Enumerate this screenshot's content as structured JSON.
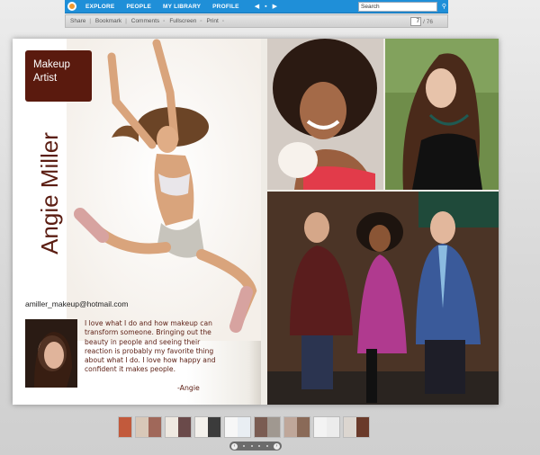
{
  "nav": {
    "items": [
      "EXPLORE",
      "PEOPLE",
      "MY LIBRARY",
      "PROFILE"
    ],
    "search_value": "Search"
  },
  "toolbar": {
    "share": "Share",
    "bookmark": "Bookmark",
    "comments": "Comments",
    "fullscreen": "Fullscreen",
    "print": "Print",
    "page_current": "7",
    "page_total": "/ 76"
  },
  "left_page": {
    "badge_line1": "Makeup",
    "badge_line2": "Artist",
    "name": "Angie Miller",
    "email": "amiller_makeup@hotmail.com",
    "bio": "I love what I do and how makeup can transform someone. Bringing out the beauty in people and seeing their reaction is probably my favorite thing about what I do. I love how happy and confident it makes people.",
    "signature": "-Angie"
  },
  "colors": {
    "nav_blue": "#1f8fd8",
    "brand_maroon": "#5b1d12",
    "badge_bg": "#5a1a0e"
  }
}
